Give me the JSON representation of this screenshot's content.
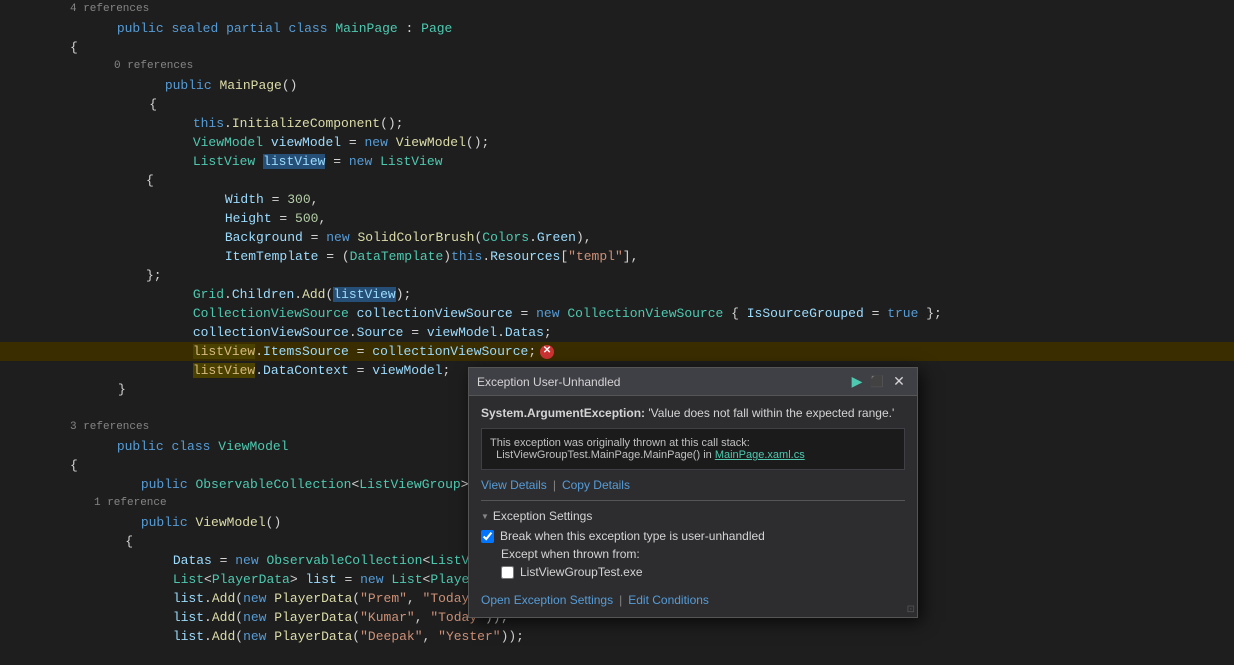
{
  "code": {
    "lines": [
      {
        "num": "",
        "content": "4 references",
        "type": "ref",
        "highlighted": false
      },
      {
        "num": "",
        "content": "public sealed partial class MainPage : Page",
        "type": "code",
        "highlighted": false
      },
      {
        "num": "",
        "content": "{",
        "type": "code",
        "highlighted": false
      },
      {
        "num": "",
        "content": "    0 references",
        "type": "ref",
        "highlighted": false
      },
      {
        "num": "",
        "content": "    public MainPage()",
        "type": "code",
        "highlighted": false
      },
      {
        "num": "",
        "content": "    {",
        "type": "code",
        "highlighted": false
      },
      {
        "num": "",
        "content": "        this.InitializeComponent();",
        "type": "code",
        "highlighted": false
      },
      {
        "num": "",
        "content": "        ViewModel viewModel = new ViewModel();",
        "type": "code",
        "highlighted": false
      },
      {
        "num": "",
        "content": "        ListView listView = new ListView",
        "type": "code",
        "highlighted": false
      },
      {
        "num": "",
        "content": "        {",
        "type": "code",
        "highlighted": false
      },
      {
        "num": "",
        "content": "            Width = 300,",
        "type": "code",
        "highlighted": false
      },
      {
        "num": "",
        "content": "            Height = 500,",
        "type": "code",
        "highlighted": false
      },
      {
        "num": "",
        "content": "            Background = new SolidColorBrush(Colors.Green),",
        "type": "code",
        "highlighted": false
      },
      {
        "num": "",
        "content": "            ItemTemplate = (DataTemplate)this.Resources[\"templ\"],",
        "type": "code",
        "highlighted": false
      },
      {
        "num": "",
        "content": "        };",
        "type": "code",
        "highlighted": false
      },
      {
        "num": "",
        "content": "        Grid.Children.Add(listView);",
        "type": "code",
        "highlighted": false
      },
      {
        "num": "",
        "content": "        CollectionViewSource collectionViewSource = new CollectionViewSource { IsSourceGrouped = true };",
        "type": "code",
        "highlighted": false
      },
      {
        "num": "",
        "content": "        collectionViewSource.Source = viewModel.Datas;",
        "type": "code",
        "highlighted": false
      },
      {
        "num": "",
        "content": "        listView.ItemsSource = collectionViewSource;",
        "type": "code",
        "highlighted": true,
        "error": true
      },
      {
        "num": "",
        "content": "        listView.DataContext = viewModel;",
        "type": "code",
        "highlighted": false
      },
      {
        "num": "",
        "content": "    }",
        "type": "code",
        "highlighted": false
      },
      {
        "num": "",
        "content": "",
        "type": "code",
        "highlighted": false
      },
      {
        "num": "",
        "content": "3 references",
        "type": "ref",
        "highlighted": false
      },
      {
        "num": "",
        "content": "public class ViewModel",
        "type": "code",
        "highlighted": false
      },
      {
        "num": "",
        "content": "{",
        "type": "code",
        "highlighted": false
      },
      {
        "num": "",
        "content": "    public ObservableCollection<ListViewGroup> Datas;",
        "type": "code",
        "highlighted": false
      },
      {
        "num": "",
        "content": "    1 reference",
        "type": "ref",
        "highlighted": false
      },
      {
        "num": "",
        "content": "    public ViewModel()",
        "type": "code",
        "highlighted": false
      },
      {
        "num": "",
        "content": "    {",
        "type": "code",
        "highlighted": false
      },
      {
        "num": "",
        "content": "        Datas = new ObservableCollection<ListViewGrou",
        "type": "code",
        "highlighted": false
      },
      {
        "num": "",
        "content": "        List<PlayerData> list = new List<PlayerData>(",
        "type": "code",
        "highlighted": false
      },
      {
        "num": "",
        "content": "        list.Add(new PlayerData(\"Prem\", \"Today\"));",
        "type": "code",
        "highlighted": false
      },
      {
        "num": "",
        "content": "        list.Add(new PlayerData(\"Kumar\", \"Today\"));",
        "type": "code",
        "highlighted": false
      },
      {
        "num": "",
        "content": "        list.Add(new PlayerData(\"Deepak\", \"Yester\"));",
        "type": "code",
        "highlighted": false
      }
    ]
  },
  "popup": {
    "title": "Exception User-Unhandled",
    "exception_type": "System.ArgumentException:",
    "exception_msg": "'Value does not fall within the expected range.'",
    "call_stack_intro": "This exception was originally thrown at this call stack:",
    "call_stack_location": "ListViewGroupTest.MainPage.MainPage() in",
    "call_stack_link": "MainPage.xaml.cs",
    "view_details": "View Details",
    "copy_details": "Copy Details",
    "settings_header": "Exception Settings",
    "checkbox1_label": "Break when this exception type is user-unhandled",
    "except_label": "Except when thrown from:",
    "checkbox2_label": "ListViewGroupTest.exe",
    "open_exception_settings": "Open Exception Settings",
    "edit_conditions": "Edit Conditions",
    "play_icon": "▶",
    "pin_icon": "📌",
    "close_icon": "✕"
  }
}
